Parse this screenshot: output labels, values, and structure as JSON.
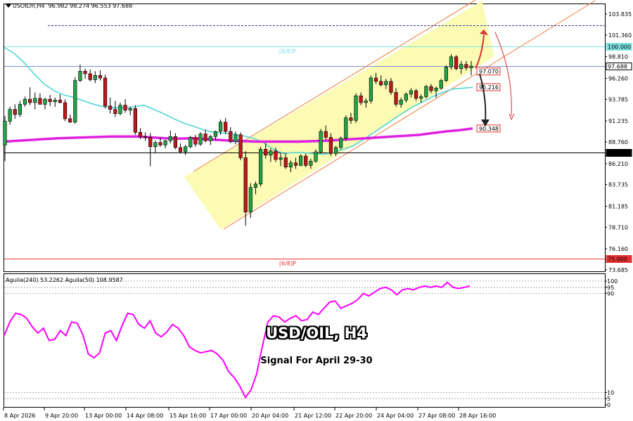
{
  "header": {
    "symbol": "USOILm,H4",
    "ohlc": "96.982 98.274 96.553 97.688"
  },
  "overlay": {
    "title": "USD/OIL, H4",
    "subtitle": "Signal For April 29-30"
  },
  "indicator": {
    "legend": "Aguila(240) 53.2262  Aguila(50) 108.9587",
    "color": "#ff00ff",
    "ticks": [
      "100",
      "95",
      "90",
      "10",
      "5",
      "0"
    ]
  },
  "colors": {
    "candle_bull": "#22a447",
    "candle_bear": "#c2161d",
    "ma_fast": "#4fd6d2",
    "ma_slow": "#e020e0",
    "channel_fill": "#fbfbb3",
    "channel_line": "#f07a30",
    "red_line": "#e85050",
    "arrow_up": "#d83030",
    "arrow_down": "#222222"
  },
  "chart_data": [
    {
      "type": "candlestick",
      "title": "USOILm,H4",
      "y_ticks": [
        "103.835",
        "101.360",
        "98.810",
        "96.260",
        "93.785",
        "91.235",
        "88.760",
        "86.210",
        "83.735",
        "81.185",
        "78.710",
        "76.160",
        "73.685"
      ],
      "ylim": [
        73.1,
        104.6
      ],
      "x_ticks": [
        "8 Apr 2026",
        "9 Apr 20:00",
        "13 Apr 00:00",
        "14 Apr 08:00",
        "15 Apr 16:00",
        "17 Apr 00:00",
        "20 Apr 04:00",
        "21 Apr 12:00",
        "22 Apr 20:00",
        "24 Apr 04:00",
        "27 Apr 08:00",
        "28 Apr 16:00"
      ],
      "levels": [
        {
          "label": "[8/8]P",
          "value": 100.0,
          "tag": "100.000",
          "color": "#7fe3e3"
        },
        {
          "label": "",
          "value": 97.688,
          "tag": "97.688",
          "color": "#8090d0"
        },
        {
          "label": "",
          "value": 87.5,
          "tag": "87.500",
          "color": "#000000"
        },
        {
          "label": "[6/8]P",
          "value": 75.0,
          "tag": "75.000",
          "color": "#e83030"
        },
        {
          "label": "",
          "value": 102.55,
          "tag": "",
          "color": "#3030a0"
        }
      ],
      "annotations": [
        "97.070",
        "95.216",
        "90.348"
      ],
      "series": [
        {
          "name": "price",
          "ohlc": [
            [
              88.4,
              91.8,
              86.5,
              91.2
            ],
            [
              91.2,
              92.9,
              90.8,
              92.6
            ],
            [
              92.6,
              93.2,
              91.5,
              92.0
            ],
            [
              92.0,
              93.6,
              91.7,
              93.2
            ],
            [
              93.2,
              94.1,
              92.9,
              93.8
            ],
            [
              93.8,
              95.2,
              93.1,
              93.4
            ],
            [
              93.4,
              94.6,
              92.6,
              93.9
            ],
            [
              93.9,
              94.5,
              93.2,
              93.2
            ],
            [
              93.2,
              94.0,
              92.6,
              93.8
            ],
            [
              93.8,
              94.3,
              93.0,
              93.5
            ],
            [
              93.5,
              94.0,
              92.9,
              93.7
            ],
            [
              93.7,
              94.4,
              93.3,
              93.4
            ],
            [
              93.4,
              93.8,
              91.2,
              91.5
            ],
            [
              91.5,
              92.0,
              91.0,
              91.1
            ],
            [
              91.1,
              96.4,
              90.9,
              96.0
            ],
            [
              96.0,
              97.9,
              95.8,
              97.1
            ],
            [
              97.1,
              97.4,
              96.2,
              96.8
            ],
            [
              96.8,
              97.3,
              95.9,
              96.1
            ],
            [
              96.1,
              97.1,
              95.7,
              96.6
            ],
            [
              96.6,
              97.2,
              96.0,
              96.3
            ],
            [
              96.3,
              96.7,
              92.7,
              93.0
            ],
            [
              93.0,
              94.0,
              92.1,
              92.6
            ],
            [
              92.6,
              93.6,
              91.7,
              92.1
            ],
            [
              92.1,
              93.4,
              91.9,
              93.1
            ],
            [
              93.1,
              93.8,
              92.2,
              92.5
            ],
            [
              92.5,
              92.9,
              91.9,
              92.7
            ],
            [
              92.7,
              93.1,
              89.6,
              89.9
            ],
            [
              89.9,
              90.4,
              89.1,
              89.4
            ],
            [
              89.4,
              89.9,
              88.9,
              89.3
            ],
            [
              89.3,
              89.8,
              85.9,
              88.2
            ],
            [
              88.2,
              88.9,
              87.5,
              88.7
            ],
            [
              88.7,
              89.3,
              88.2,
              88.4
            ],
            [
              88.4,
              89.0,
              88.0,
              88.9
            ],
            [
              88.9,
              90.1,
              88.6,
              89.4
            ],
            [
              89.4,
              89.8,
              87.9,
              88.1
            ],
            [
              88.1,
              88.6,
              87.4,
              87.6
            ],
            [
              87.6,
              88.4,
              87.2,
              88.2
            ],
            [
              88.2,
              89.5,
              88.0,
              89.3
            ],
            [
              89.3,
              89.6,
              88.2,
              88.5
            ],
            [
              88.5,
              89.9,
              88.3,
              89.7
            ],
            [
              89.7,
              90.2,
              88.7,
              88.9
            ],
            [
              88.9,
              89.6,
              88.4,
              89.4
            ],
            [
              89.4,
              90.1,
              89.0,
              90.0
            ],
            [
              90.0,
              91.4,
              89.6,
              91.1
            ],
            [
              91.1,
              91.6,
              89.7,
              90.0
            ],
            [
              90.0,
              90.5,
              88.6,
              88.8
            ],
            [
              88.8,
              90.0,
              88.5,
              89.6
            ],
            [
              89.6,
              89.9,
              86.6,
              86.9
            ],
            [
              86.9,
              87.7,
              78.9,
              80.5
            ],
            [
              80.5,
              83.9,
              79.8,
              83.4
            ],
            [
              83.4,
              84.1,
              82.6,
              83.8
            ],
            [
              83.8,
              88.2,
              83.5,
              87.9
            ],
            [
              87.9,
              88.6,
              86.8,
              87.2
            ],
            [
              87.2,
              88.0,
              86.4,
              87.7
            ],
            [
              87.7,
              88.1,
              86.4,
              86.7
            ],
            [
              86.7,
              87.5,
              85.9,
              86.9
            ],
            [
              86.9,
              87.4,
              85.6,
              85.8
            ],
            [
              85.8,
              86.6,
              85.2,
              86.3
            ],
            [
              86.3,
              86.9,
              85.6,
              86.0
            ],
            [
              86.0,
              87.3,
              85.9,
              87.1
            ],
            [
              87.1,
              87.4,
              85.8,
              86.0
            ],
            [
              86.0,
              86.8,
              85.6,
              86.5
            ],
            [
              86.5,
              87.9,
              86.3,
              87.6
            ],
            [
              87.6,
              90.3,
              87.4,
              90.0
            ],
            [
              90.0,
              90.7,
              89.0,
              89.3
            ],
            [
              89.3,
              89.8,
              87.1,
              87.4
            ],
            [
              87.4,
              88.3,
              87.1,
              88.1
            ],
            [
              88.1,
              89.4,
              87.9,
              89.2
            ],
            [
              89.2,
              91.9,
              88.9,
              91.6
            ],
            [
              91.6,
              92.2,
              90.9,
              91.3
            ],
            [
              91.3,
              94.5,
              91.0,
              94.2
            ],
            [
              94.2,
              94.6,
              93.1,
              93.4
            ],
            [
              93.4,
              93.9,
              92.8,
              93.6
            ],
            [
              93.6,
              96.6,
              93.3,
              96.3
            ],
            [
              96.3,
              96.9,
              95.6,
              95.9
            ],
            [
              95.9,
              96.6,
              95.3,
              95.5
            ],
            [
              95.5,
              96.2,
              95.0,
              95.9
            ],
            [
              95.9,
              96.3,
              94.3,
              94.6
            ],
            [
              94.6,
              95.1,
              92.9,
              93.2
            ],
            [
              93.2,
              94.0,
              92.8,
              93.7
            ],
            [
              93.7,
              94.6,
              93.4,
              94.4
            ],
            [
              94.4,
              95.1,
              94.0,
              94.8
            ],
            [
              94.8,
              95.0,
              93.6,
              93.9
            ],
            [
              93.9,
              94.4,
              93.4,
              94.1
            ],
            [
              94.1,
              95.5,
              93.9,
              95.3
            ],
            [
              95.3,
              95.6,
              94.5,
              94.8
            ],
            [
              94.8,
              95.3,
              94.0,
              95.1
            ],
            [
              95.1,
              96.2,
              94.9,
              96.0
            ],
            [
              96.0,
              97.8,
              95.8,
              97.6
            ],
            [
              97.6,
              99.1,
              97.3,
              98.8
            ],
            [
              98.8,
              99.0,
              97.2,
              97.4
            ],
            [
              97.4,
              98.3,
              96.8,
              97.9
            ],
            [
              97.9,
              98.3,
              97.2,
              97.5
            ],
            [
              97.5,
              98.3,
              96.6,
              97.7
            ]
          ]
        },
        {
          "name": "MA fast",
          "values": [
            99.9,
            99.2,
            98.1,
            96.8,
            95.6,
            94.8,
            94.3,
            94.0,
            93.6,
            93.2,
            92.9,
            92.8,
            92.8,
            92.9,
            93.1,
            92.6,
            92.1,
            91.5,
            91.0,
            90.6,
            90.2,
            89.9,
            89.8,
            89.7,
            89.5,
            89.2,
            88.7,
            87.9,
            87.4,
            87.5,
            87.5,
            87.4,
            87.3,
            87.5,
            87.9,
            88.3,
            89.0,
            89.8,
            90.6,
            91.4,
            92.2,
            92.9,
            93.5,
            94.1,
            94.6,
            95.0,
            95.1,
            95.2
          ]
        },
        {
          "name": "MA slow",
          "values": [
            88.8,
            88.9,
            89.0,
            89.1,
            89.2,
            89.25,
            89.3,
            89.35,
            89.4,
            89.4,
            89.4,
            89.3,
            89.2,
            89.15,
            89.2,
            89.1,
            89.0,
            88.9,
            88.85,
            88.8,
            88.8,
            88.8,
            88.8,
            88.85,
            88.9,
            89.0,
            89.1,
            89.2,
            89.3,
            89.4,
            89.5,
            89.6,
            89.8,
            90.0,
            90.15,
            90.35
          ]
        }
      ]
    },
    {
      "type": "line",
      "title": "Aguila(240) 53.2262  Aguila(50) 108.9587",
      "ylim": [
        0,
        100
      ],
      "series": [
        {
          "name": "Aguila",
          "values": [
            56,
            67,
            74,
            73,
            70,
            63,
            58,
            62,
            52,
            53,
            60,
            56,
            67,
            66,
            57,
            41,
            38,
            42,
            58,
            60,
            52,
            64,
            74,
            73,
            65,
            62,
            68,
            58,
            55,
            59,
            65,
            62,
            56,
            47,
            44,
            42,
            43,
            44,
            41,
            36,
            27,
            22,
            15,
            6,
            12,
            25,
            47,
            67,
            72,
            71,
            67,
            70,
            72,
            68,
            69,
            75,
            73,
            78,
            83,
            84,
            78,
            80,
            82,
            85,
            90,
            88,
            91,
            94,
            95,
            93,
            89,
            93,
            94,
            93,
            95,
            96,
            95,
            96,
            95,
            99,
            95,
            94,
            95,
            96
          ]
        }
      ]
    }
  ]
}
